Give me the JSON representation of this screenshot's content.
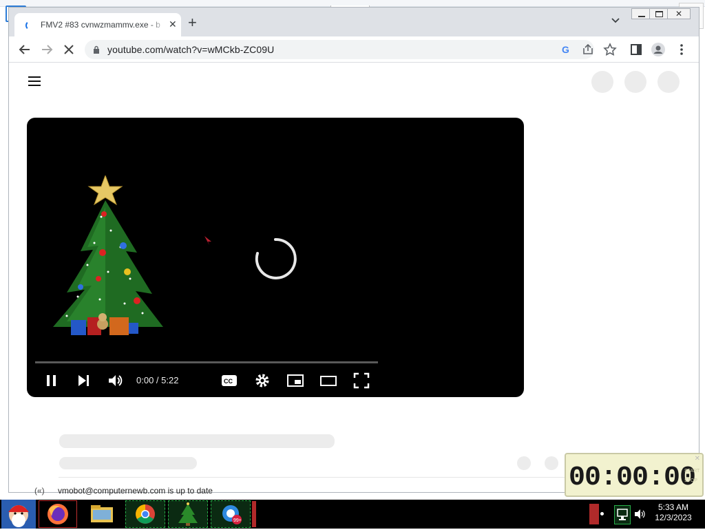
{
  "browser": {
    "tab_title": "FMV2 #83 cvnwzmammv.exe - b",
    "address": "youtube.com/watch?v=wMCkb-ZC09U"
  },
  "player": {
    "timecode": "0:00 / 5:22",
    "state": "loading",
    "progress_fraction": 0.0
  },
  "download_bar": {
    "text": "vmobot@computernewb.com is up to date"
  },
  "timer": {
    "digits": "00:00:00",
    "side_labels": [
      "START",
      "STOP"
    ]
  },
  "taskbar": {
    "apps": [
      {
        "name": "start",
        "icon": "santa-icon"
      },
      {
        "name": "firefox",
        "icon": "firefox-icon"
      },
      {
        "name": "file-explorer",
        "icon": "folder-icon"
      },
      {
        "name": "chrome",
        "icon": "chrome-icon"
      },
      {
        "name": "christmas-tree",
        "icon": "tree-icon"
      },
      {
        "name": "messenger",
        "icon": "chat-icon",
        "badge": "99+"
      }
    ],
    "clock_time": "5:33 AM",
    "clock_date": "12/3/2023"
  },
  "colors": {
    "accent": "#1a73e8",
    "taskbar_bg": "#000000",
    "timer_bg": "#f2f2cf",
    "tab_bar_bg": "#dee1e6"
  }
}
